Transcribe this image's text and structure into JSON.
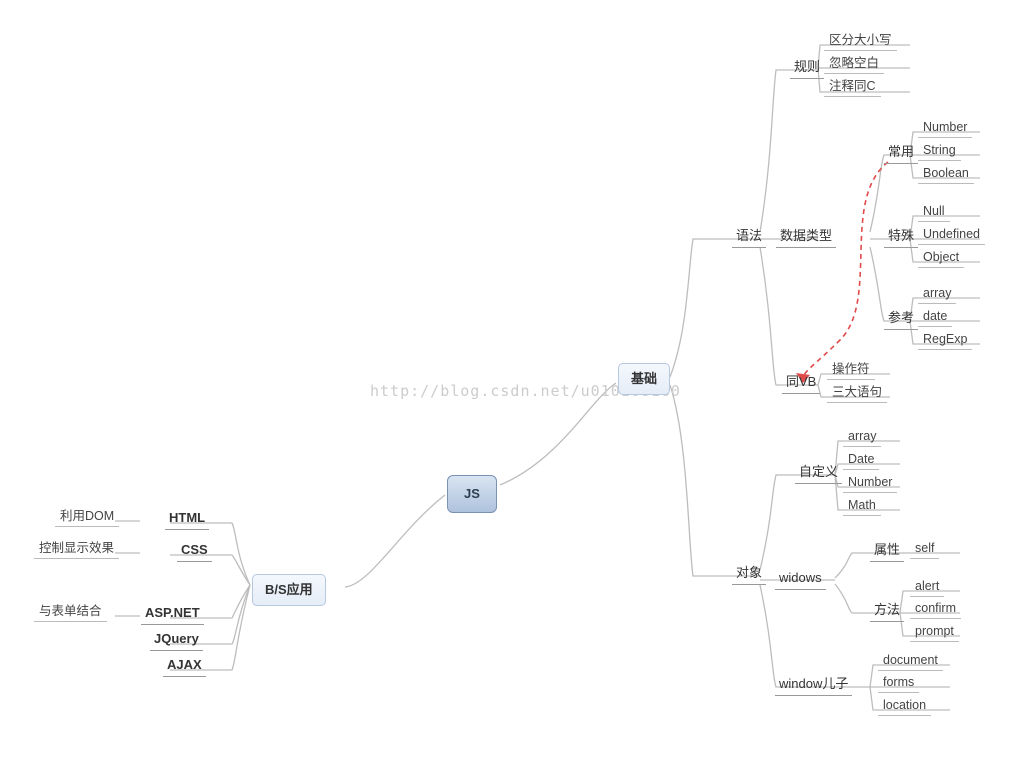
{
  "watermark": "http://blog.csdn.net/u010168160",
  "root": "JS",
  "branches": {
    "basics": {
      "label": "基础",
      "syntax": {
        "label": "语法",
        "rules": {
          "label": "规则",
          "items": [
            "区分大小写",
            "忽略空白",
            "注释同C"
          ]
        },
        "datatypes": {
          "label": "数据类型",
          "common": {
            "label": "常用",
            "items": [
              "Number",
              "String",
              "Boolean"
            ]
          },
          "special": {
            "label": "特殊",
            "items": [
              "Null",
              "Undefined",
              "Object"
            ]
          },
          "ref": {
            "label": "参考",
            "items": [
              "array",
              "date",
              "RegExp"
            ]
          }
        },
        "samevb": {
          "label": "同VB",
          "items": [
            "操作符",
            "三大语句"
          ]
        }
      },
      "objects": {
        "label": "对象",
        "custom": {
          "label": "自定义",
          "items": [
            "array",
            "Date",
            "Number",
            "Math"
          ]
        },
        "widows": {
          "label": "widows",
          "attr": {
            "label": "属性",
            "items": [
              "self"
            ]
          },
          "method": {
            "label": "方法",
            "items": [
              "alert",
              "confirm",
              "prompt"
            ]
          }
        },
        "windowson": {
          "label": "window儿子",
          "items": [
            "document",
            "forms",
            "location"
          ]
        }
      }
    },
    "bs": {
      "label": "B/S应用",
      "items": [
        "HTML",
        "CSS",
        "ASP.NET",
        "JQuery",
        "AJAX"
      ],
      "notes": [
        "利用DOM",
        "控制显示效果",
        "与表单结合"
      ]
    }
  }
}
